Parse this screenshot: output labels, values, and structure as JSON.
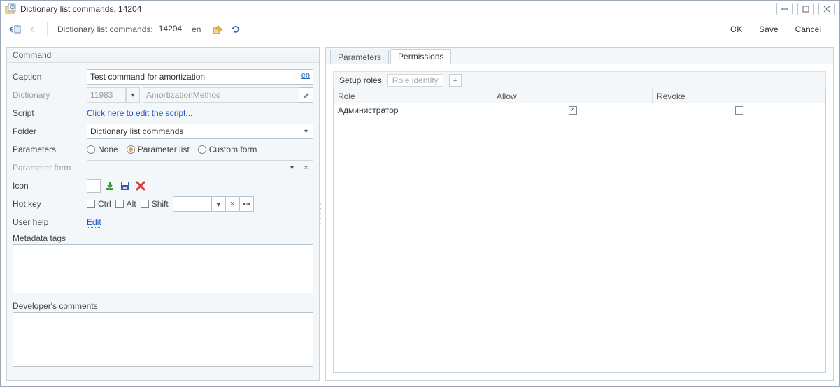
{
  "window": {
    "title": "Dictionary list commands, 14204"
  },
  "toolbar": {
    "breadcrumb_label": "Dictionary list commands:",
    "breadcrumb_id": "14204",
    "lang": "en",
    "ok": "OK",
    "save": "Save",
    "cancel": "Cancel"
  },
  "group_title": "Command",
  "labels": {
    "caption": "Caption",
    "dictionary": "Dictionary",
    "script": "Script",
    "folder": "Folder",
    "parameters": "Parameters",
    "parameter_form": "Parameter form",
    "icon": "Icon",
    "hotkey": "Hot key",
    "user_help": "User help",
    "metadata": "Metadata tags",
    "dev_comments": "Developer's comments"
  },
  "values": {
    "caption": "Test command for amortization",
    "caption_lang": "en",
    "dictionary_id": "11983",
    "dictionary_name": "AmortizationMethod",
    "script_link": "Click here to edit the script...",
    "folder": "Dictionary list commands",
    "user_help_link": "Edit"
  },
  "radios": {
    "none": "None",
    "param_list": "Parameter list",
    "custom_form": "Custom form",
    "selected": "param_list"
  },
  "hotkey": {
    "ctrl": "Ctrl",
    "alt": "Alt",
    "shift": "Shift"
  },
  "tabs": {
    "parameters": "Parameters",
    "permissions": "Permissions",
    "active": "permissions"
  },
  "roles": {
    "setup_label": "Setup roles",
    "identity_placeholder": "Role identity",
    "columns": {
      "role": "Role",
      "allow": "Allow",
      "revoke": "Revoke"
    },
    "rows": [
      {
        "role": "Администратор",
        "allow": true,
        "revoke": false
      }
    ]
  }
}
